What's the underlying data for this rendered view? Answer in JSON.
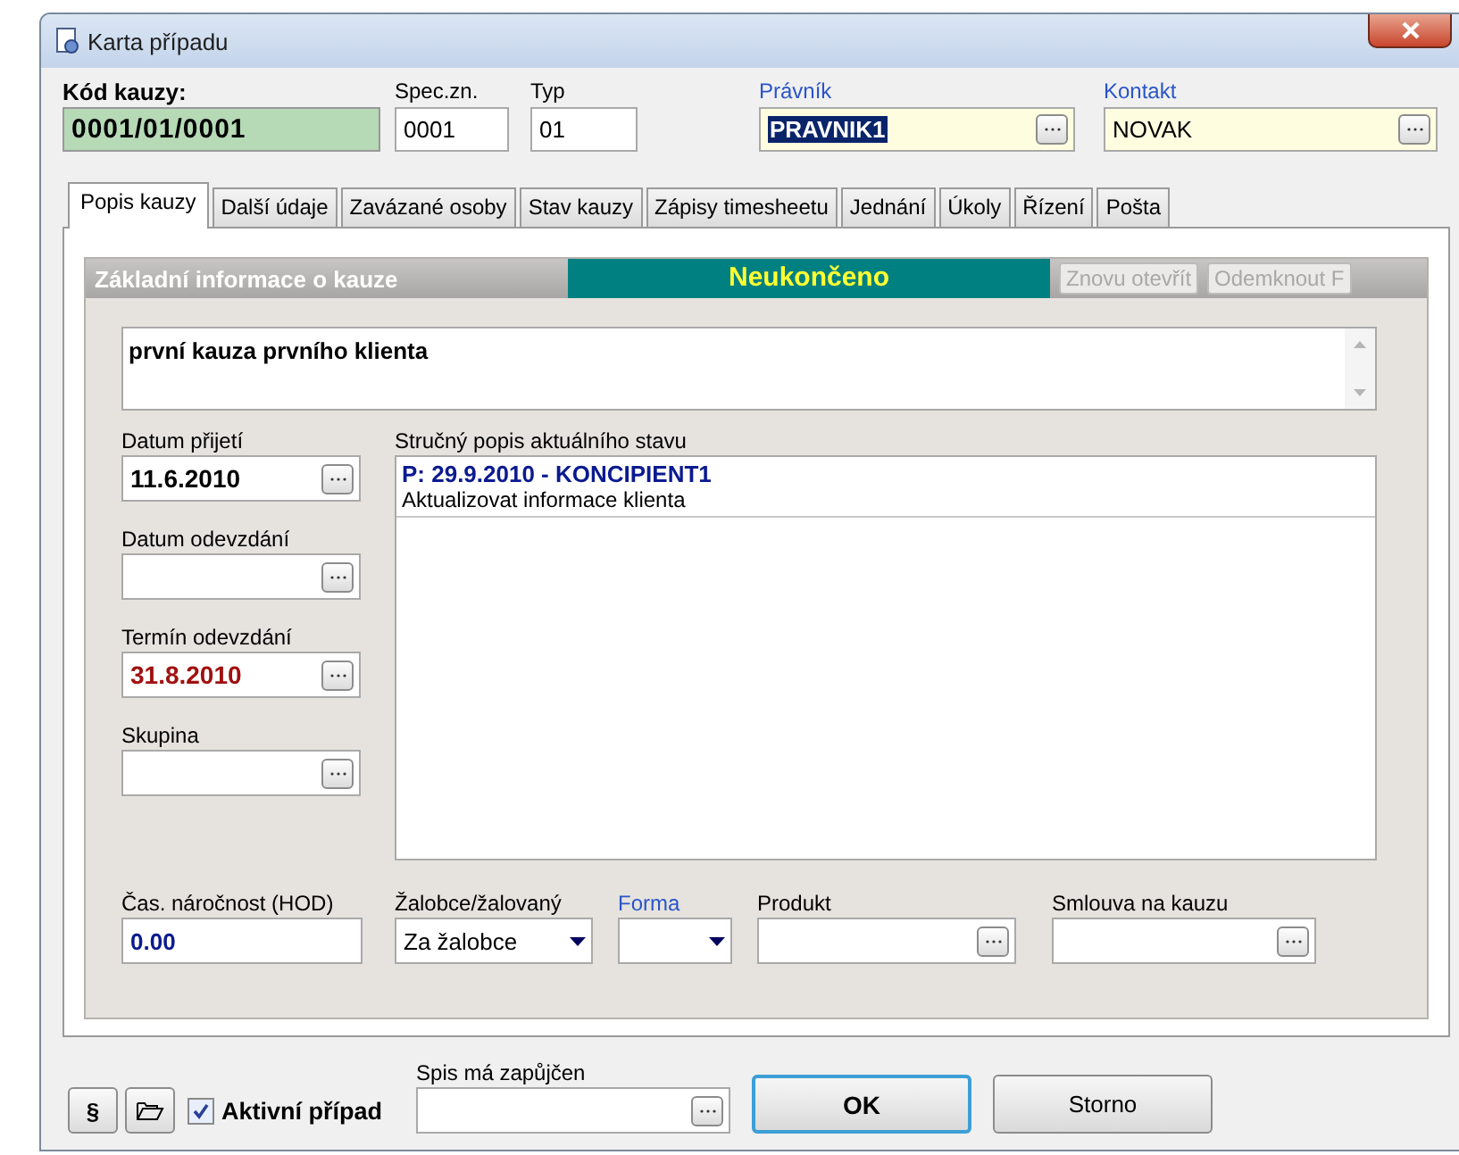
{
  "window": {
    "title": "Karta případu"
  },
  "header": {
    "code": {
      "label": "Kód kauzy:",
      "value": "0001/01/0001"
    },
    "fields": [
      {
        "label": "Spec.zn.",
        "value": "0001",
        "linked": false,
        "kind": "text"
      },
      {
        "label": "Typ",
        "value": "01",
        "linked": false,
        "kind": "text"
      },
      {
        "label": "Právník",
        "value": "PRAVNIK1",
        "linked": true,
        "kind": "lookup",
        "text_selected": true
      },
      {
        "label": "Kontakt",
        "value": "NOVAK",
        "linked": true,
        "kind": "lookup",
        "text_selected": false
      }
    ]
  },
  "tabs": [
    {
      "label": "Popis kauzy",
      "selected": true
    },
    {
      "label": "Další údaje",
      "selected": false
    },
    {
      "label": "Zavázané osoby",
      "selected": false
    },
    {
      "label": "Stav kauzy",
      "selected": false
    },
    {
      "label": "Zápisy timesheetu",
      "selected": false
    },
    {
      "label": "Jednání",
      "selected": false
    },
    {
      "label": "Úkoly",
      "selected": false
    },
    {
      "label": "Řízení",
      "selected": false
    },
    {
      "label": "Pošta",
      "selected": false
    }
  ],
  "group": {
    "title": "Základní informace o kauze",
    "status": "Neukončeno",
    "buttons": [
      {
        "label": "Znovu otevřít",
        "disabled": true
      },
      {
        "label": "Odemknout F",
        "disabled": true
      }
    ],
    "description": "první kauza prvního klienta",
    "dates": [
      {
        "label": "Datum přijetí",
        "value": "11.6.2010",
        "highlighted": false
      },
      {
        "label": "Datum odevzdání"
      },
      {
        "label": "Termín odevzdání",
        "value": "31.8.2010",
        "highlighted": true
      },
      {
        "label": "Skupina"
      }
    ],
    "state": {
      "label": "Stručný popis aktuálního stavu",
      "entries": [
        {
          "heading": "P: 29.9.2010 - KONCIPIENT1",
          "text": "Aktualizovat informace klienta"
        }
      ]
    },
    "bottom_fields": [
      {
        "label": "Čas. náročnost (HOD)",
        "value": "0.00",
        "kind": "text",
        "linked": false
      },
      {
        "label": "Žalobce/žalovaný",
        "value": "Za žalobce",
        "kind": "dropdown",
        "linked": false
      },
      {
        "label": "Forma",
        "kind": "dropdown",
        "linked": true
      },
      {
        "label": "Produkt",
        "kind": "lookup",
        "linked": false
      },
      {
        "label": "Smlouva na kauzu",
        "kind": "lookup",
        "linked": false
      }
    ]
  },
  "footer": {
    "section_button": "§",
    "active": {
      "label": "Aktivní případ",
      "checked": true
    },
    "loan": {
      "label": "Spis má zapůjčen"
    },
    "buttons": [
      {
        "label": "OK",
        "default": true
      },
      {
        "label": "Storno",
        "default": false
      }
    ]
  }
}
